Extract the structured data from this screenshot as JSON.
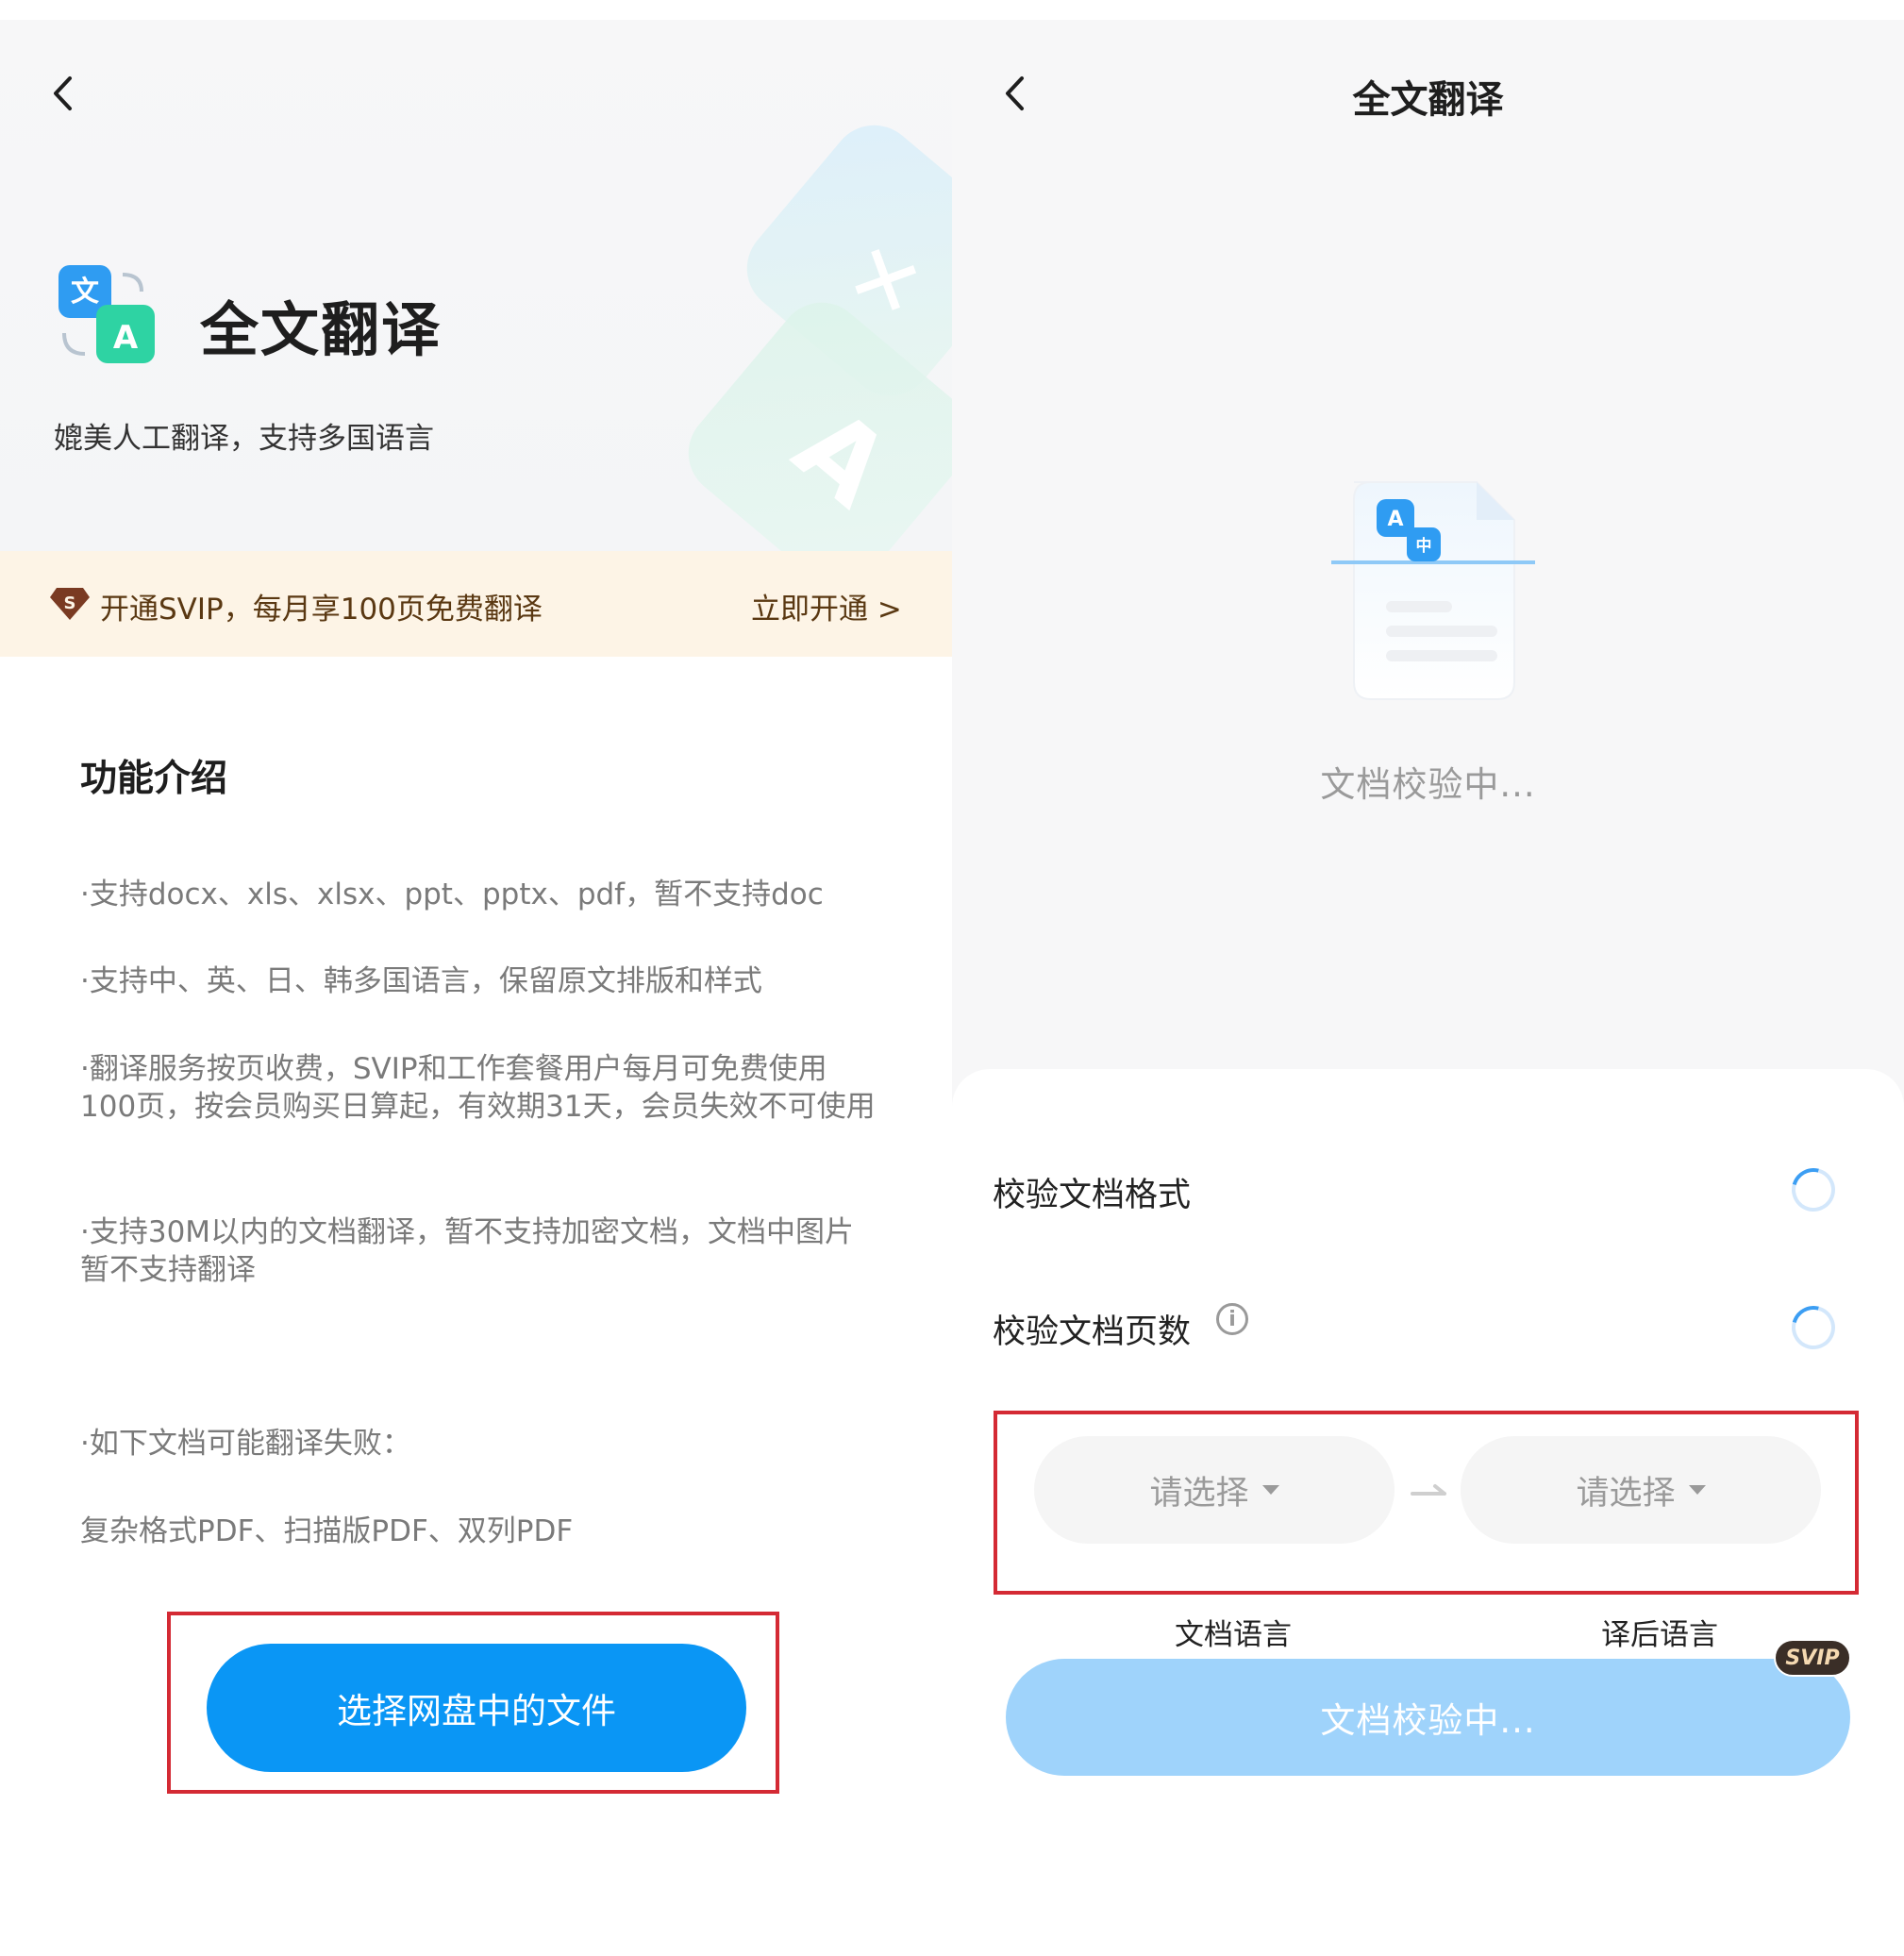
{
  "left": {
    "hero_title": "全文翻译",
    "hero_subtitle": "媲美人工翻译，支持多国语言",
    "vip_banner": {
      "text": "开通SVIP，每月享100页免费翻译",
      "action": "立即开通 >"
    },
    "section_title": "功能介绍",
    "features": [
      "·支持docx、xls、xlsx、ppt、pptx、pdf，暂不支持doc",
      "·支持中、英、日、韩多国语言，保留原文排版和样式",
      "·翻译服务按页收费，SVIP和工作套餐用户每月可免费使用100页，按会员购买日算起，有效期31天，会员失效不可使用",
      "·支持30M以内的文档翻译，暂不支持加密文档，文档中图片暂不支持翻译"
    ],
    "fail_title": "·如下文档可能翻译失败：",
    "fail_list": "复杂格式PDF、扫描版PDF、双列PDF",
    "primary_button": "选择网盘中的文件"
  },
  "right": {
    "title": "全文翻译",
    "status_text": "文档校验中...",
    "checks": [
      {
        "label": "校验文档格式",
        "icon": "loading-spinner"
      },
      {
        "label": "校验文档页数",
        "icon": "loading-spinner",
        "info": "info-icon"
      }
    ],
    "source_lang": {
      "value": "请选择",
      "caption": "文档语言"
    },
    "target_lang": {
      "value": "请选择",
      "caption": "译后语言"
    },
    "bottom_button": "文档校验中...",
    "badge": "SVIP"
  },
  "colors": {
    "primary_blue": "#0a96f5",
    "disabled_blue": "#9fd3fb",
    "highlight_red": "#d42a34",
    "vip_banner_bg": "#fdf4e6",
    "vip_text": "#5a3812"
  }
}
